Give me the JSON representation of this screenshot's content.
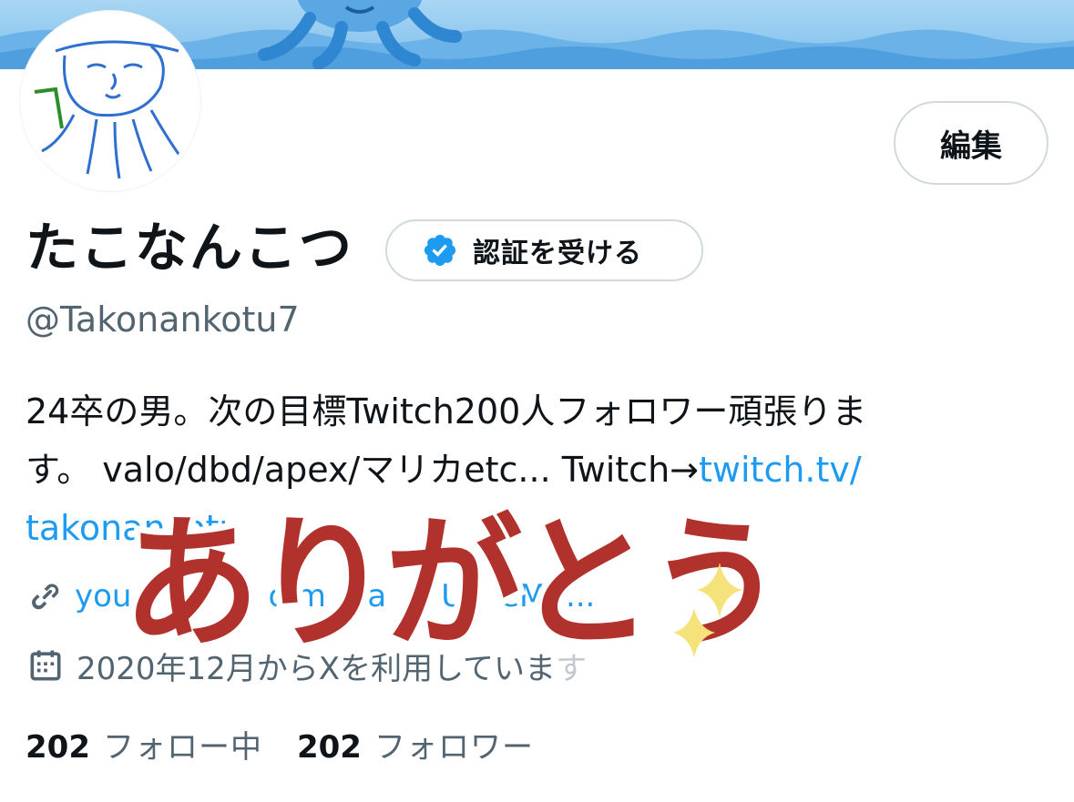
{
  "profile": {
    "display_name": "たこなんこつ",
    "handle": "@Takonankotu7",
    "bio_line1": "24卒の男。次の目標Twitch200人フォロワー頑張りま",
    "bio_line2_text": "す。 valo/dbd/apex/マリカetc... Twitch→",
    "bio_line2_link": "twitch.tv/",
    "bio_line3_link": "takonan",
    "bio_line3_link_tail": "kotu",
    "url": "you",
    "url_mid": "oim",
    "url_mid2": "na",
    "url_tail": "U",
    "url_end": "eMn...",
    "joined": "2020年12月からXを利用していま",
    "joined_tail": "す"
  },
  "buttons": {
    "edit_label": "編集",
    "verify_label": "認証を受ける"
  },
  "stats": {
    "following_count": "202",
    "following_label": "フォロー中",
    "followers_count": "202",
    "followers_label": "フォロワー"
  },
  "sticker": {
    "text": "ありがとう"
  },
  "icons": {
    "verified": "verified-badge-icon",
    "link": "link-icon",
    "calendar": "calendar-icon"
  },
  "colors": {
    "link": "#1d9bf0",
    "secondary_text": "#536471",
    "primary_text": "#0f1419",
    "border": "#cfd9de",
    "sticker_red": "#b1312c",
    "sparkle": "#f5e27a"
  }
}
